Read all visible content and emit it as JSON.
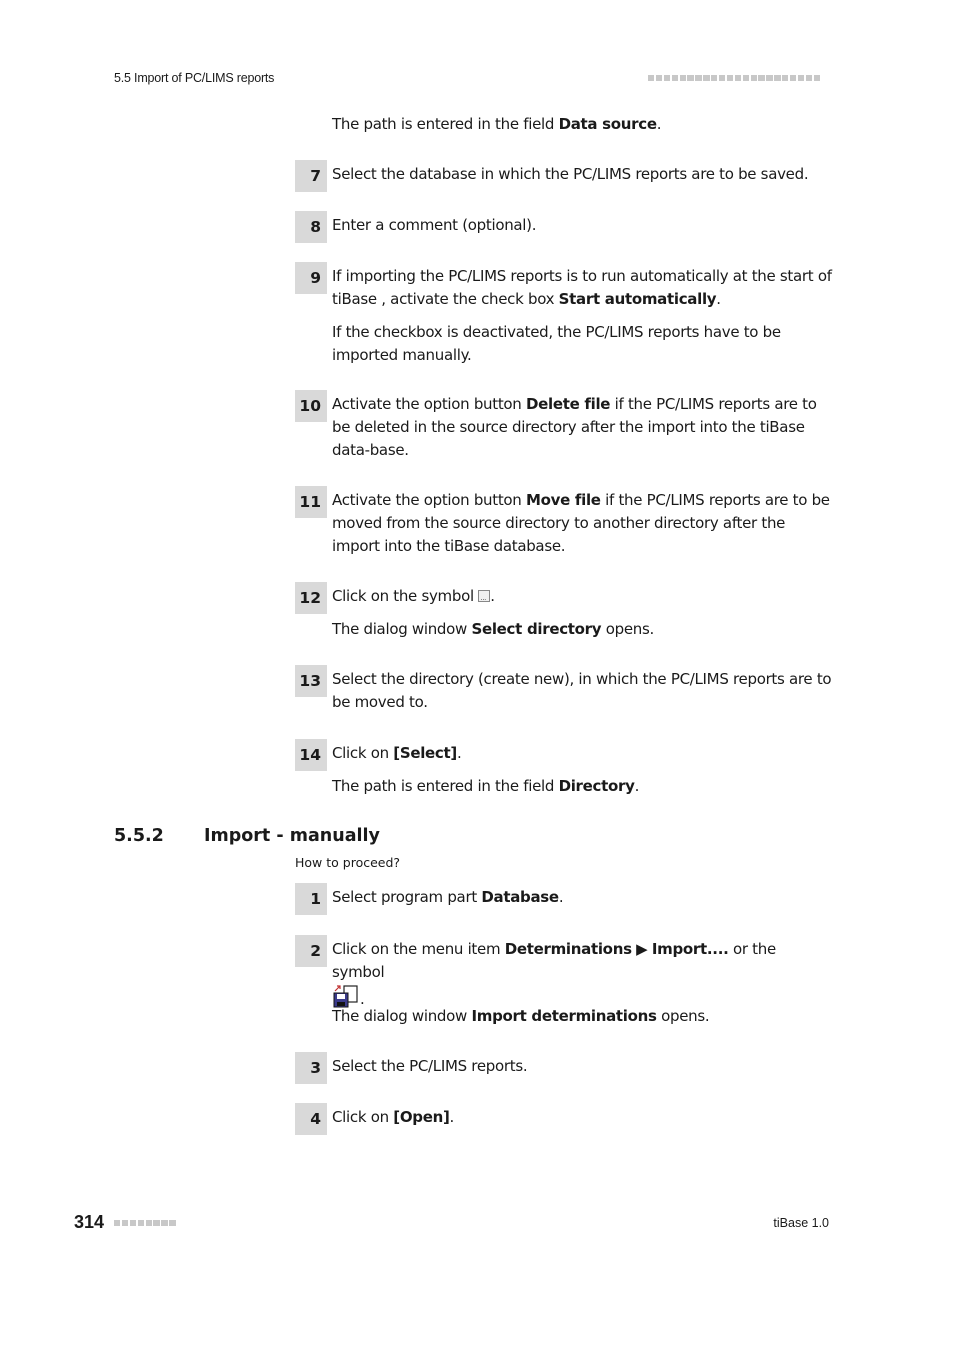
{
  "header": {
    "section": "5.5 Import of PC/LIMS reports"
  },
  "footer": {
    "page_number": "314",
    "product": "tiBase 1.0"
  },
  "top_result": {
    "prefix": "The path is entered in the field ",
    "bold": "Data source",
    "suffix": "."
  },
  "steps_a": [
    {
      "num": "7",
      "text": "Select the database in which the PC/LIMS reports are to be saved."
    },
    {
      "num": "8",
      "text": "Enter a comment (optional)."
    },
    {
      "num": "9",
      "pre": "If importing the PC/LIMS reports is to run automatically at the start of tiBase , activate the check box ",
      "bold": "Start automatically",
      "post": ".",
      "result": "If the checkbox is deactivated, the PC/LIMS reports have to be imported manually."
    },
    {
      "num": "10",
      "pre": "Activate the option button ",
      "bold": "Delete file",
      "post": " if the PC/LIMS reports are to be deleted in the source directory after the import into the tiBase  data-base."
    },
    {
      "num": "11",
      "pre": "Activate the option button ",
      "bold": "Move file",
      "post": " if the PC/LIMS reports are to be moved from the source directory to another directory after the import into the tiBase  database."
    },
    {
      "num": "12",
      "pre": "Click on the symbol ",
      "icon": "browse-icon",
      "post": ".",
      "result_pre": "The dialog window ",
      "result_bold": "Select directory",
      "result_post": " opens."
    },
    {
      "num": "13",
      "text": "Select the directory (create new), in which the PC/LIMS reports are to be moved to."
    },
    {
      "num": "14",
      "pre": "Click on ",
      "bold": "[Select]",
      "post": ".",
      "result_pre": "The path is entered in the field ",
      "result_bold": "Directory",
      "result_post": "."
    }
  ],
  "section": {
    "number": "5.5.2",
    "title": "Import - manually",
    "intro": "How to proceed?"
  },
  "steps_b": [
    {
      "num": "1",
      "pre": "Select program part ",
      "bold": "Database",
      "post": "."
    },
    {
      "num": "2",
      "pre": "Click on the menu item ",
      "bold": "Determinations",
      "arrow": " ▶ ",
      "bold2": "Import....",
      "post": " or the symbol",
      "icon": "import-icon",
      "post2": ".",
      "result_pre": "The dialog window ",
      "result_bold": "Import determinations",
      "result_post": " opens."
    },
    {
      "num": "3",
      "text": "Select the PC/LIMS reports."
    },
    {
      "num": "4",
      "pre": "Click on ",
      "bold": "[Open]",
      "post": "."
    }
  ]
}
